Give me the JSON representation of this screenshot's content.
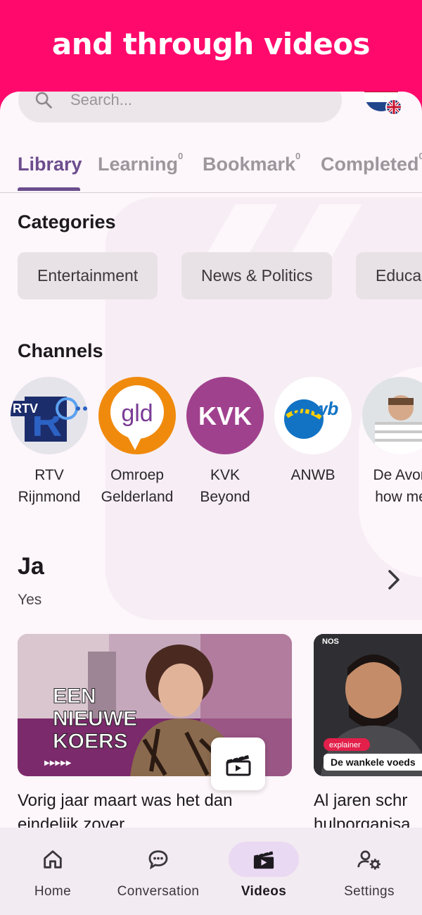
{
  "banner": {
    "text": "and through videos"
  },
  "search": {
    "placeholder": "Search..."
  },
  "tabs": [
    {
      "label": "Library",
      "count": "",
      "active": true
    },
    {
      "label": "Learning",
      "count": "0",
      "active": false
    },
    {
      "label": "Bookmark",
      "count": "0",
      "active": false
    },
    {
      "label": "Completed",
      "count": "0",
      "active": false
    }
  ],
  "categories": {
    "title": "Categories",
    "items": [
      "Entertainment",
      "News & Politics",
      "Educa"
    ]
  },
  "channels": {
    "title": "Channels",
    "items": [
      {
        "name_line1": "RTV",
        "name_line2": "Rijnmond",
        "logo_text": "RTV"
      },
      {
        "name_line1": "Omroep",
        "name_line2": "Gelderland",
        "logo_text": "gld"
      },
      {
        "name_line1": "KVK",
        "name_line2": "Beyond",
        "logo_text": "KVK"
      },
      {
        "name_line1": "ANWB",
        "name_line2": "",
        "logo_text": "anwb"
      },
      {
        "name_line1": "De Avon",
        "name_line2": "how me",
        "logo_text": ""
      }
    ]
  },
  "section": {
    "title": "Ja",
    "subtitle": "Yes"
  },
  "videos": [
    {
      "title_line1": "Vorig jaar maart was het dan",
      "title_line2": "eindelijk zover...",
      "overlay_lines": [
        "EEN",
        "NIEUWE",
        "KOERS"
      ]
    },
    {
      "title_line1": "Al jaren schr",
      "title_line2": "hulporganisa",
      "badge": "explainer",
      "caption": "De wankele voeds",
      "logo": "NOS"
    }
  ],
  "nav": [
    {
      "label": "Home",
      "icon": "home-icon",
      "active": false
    },
    {
      "label": "Conversation",
      "icon": "chat-icon",
      "active": false
    },
    {
      "label": "Videos",
      "icon": "clapperboard-icon",
      "active": true
    },
    {
      "label": "Settings",
      "icon": "user-settings-icon",
      "active": false
    }
  ],
  "colors": {
    "banner": "#ff0a6c",
    "accent": "#6c4d8d",
    "background": "#fdf6fb",
    "navbar": "#f2ebf1"
  }
}
